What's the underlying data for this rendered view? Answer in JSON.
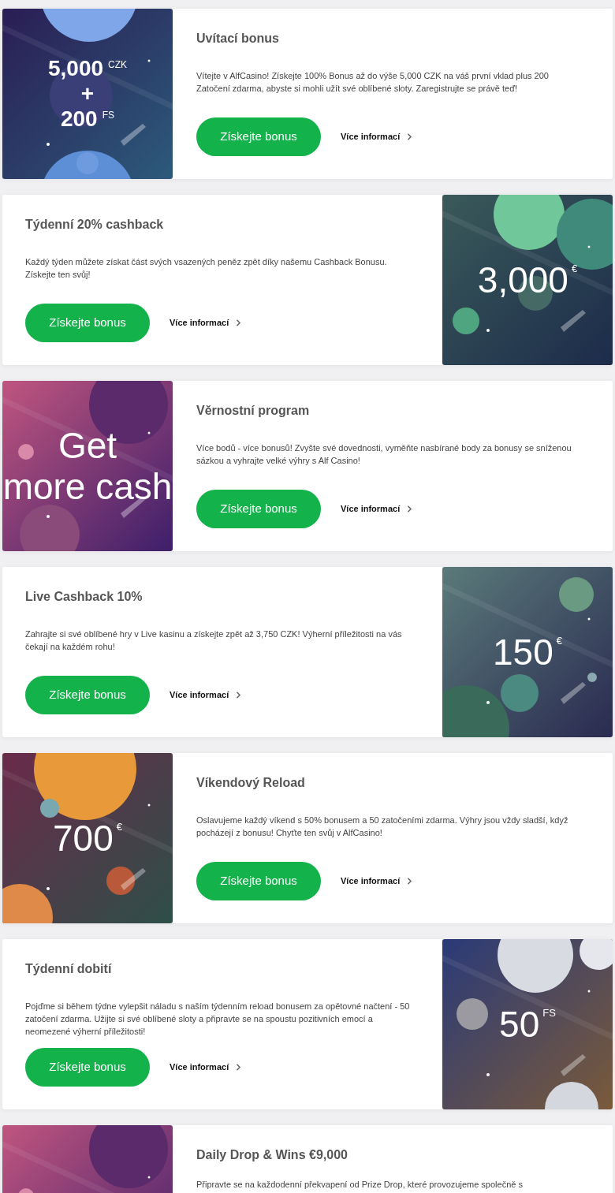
{
  "promotions": [
    {
      "title": "Uvítací bonus",
      "description": "Vítejte v AlfCasino! Získejte 100% Bonus až do výše 5,000 CZK na váš první vklad plus 200 Zatočení zdarma, abyste si mohli užít své oblíbené sloty. Zaregistrujte se právě teď!",
      "art": {
        "kind": "blue",
        "bold": true,
        "lines": [
          {
            "value": "5,000",
            "unit": "CZK"
          },
          {
            "value": "+"
          },
          {
            "value": "200",
            "unit": "FS"
          }
        ]
      },
      "button": "Získejte bonus",
      "link": "Více informací"
    },
    {
      "title": "Týdenní 20% cashback",
      "description": "Každý týden můžete získat část svých vsazených peněz zpět díky našemu Cashback Bonusu. Získejte ten svůj!",
      "art": {
        "kind": "green",
        "bold": false,
        "lines": [
          {
            "value": "3,000",
            "unit": "€"
          }
        ]
      },
      "button": "Získejte bonus",
      "link": "Více informací"
    },
    {
      "title": "Věrnostní program",
      "description": "Více bodů - více bonusů! Zvyšte své dovednosti, vyměňte nasbírané body za bonusy se sníženou sázkou a vyhrajte velké výhry s Alf Casino!",
      "art": {
        "kind": "pink",
        "bold": false,
        "lines": [
          {
            "value": "Get"
          },
          {
            "value": "more cash"
          }
        ]
      },
      "button": "Získejte bonus",
      "link": "Více informací"
    },
    {
      "title": "Live Cashback 10%",
      "description": "Zahrajte si své oblíbené hry v Live kasinu a získejte zpět až 3,750 CZK! Výherní příležitosti na vás čekají na každém rohu!",
      "art": {
        "kind": "teal",
        "bold": false,
        "lines": [
          {
            "value": "150",
            "unit": "€"
          }
        ]
      },
      "button": "Získejte bonus",
      "link": "Více informací"
    },
    {
      "title": "Víkendový Reload",
      "description": "Oslavujeme každý víkend s 50% bonusem a 50 zatočeními zdarma. Výhry jsou vždy sladší, když pocházejí z bonusu! Chyťte ten svůj v AlfCasino!",
      "art": {
        "kind": "sunset",
        "bold": false,
        "lines": [
          {
            "value": "700",
            "unit": "€"
          }
        ]
      },
      "button": "Získejte bonus",
      "link": "Více informací"
    },
    {
      "title": "Týdenní dobití",
      "description": "Pojďme si během týdne vylepšit náladu s naším týdenním reload bonusem za opětovné načtení - 50 zatočení zdarma. Užijte si své oblíbené sloty a připravte se na spoustu pozitivních emocí a neomezené výherní příležitosti!",
      "art": {
        "kind": "moon",
        "bold": false,
        "lines": [
          {
            "value": "50",
            "unit": "FS"
          }
        ]
      },
      "button": "Získejte bonus",
      "link": "Více informací"
    },
    {
      "title": "Daily Drop & Wins €9,000",
      "description": "Připravte se na každodenní překvapení od Prize Drop, které provozujeme společně s",
      "art": {
        "kind": "pink"
      }
    }
  ]
}
